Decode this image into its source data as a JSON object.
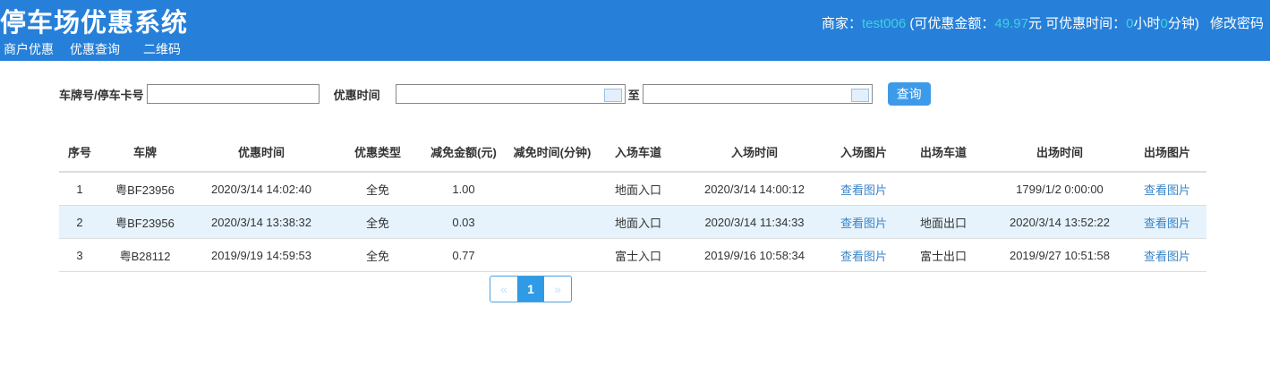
{
  "header": {
    "title": "停车场优惠系统",
    "nav": [
      "商户优惠",
      "优惠查询",
      "二维码"
    ],
    "merchant_label": "商家：",
    "merchant": "test006",
    "amount_label": " (可优惠金额：",
    "amount": "49.97",
    "yuan": "元 可优惠时间：",
    "hours": "0",
    "hour_unit": "小时",
    "minutes": "0",
    "minute_unit": "分钟) ",
    "change_password": "修改密码"
  },
  "search": {
    "plate_label": "车牌号/停车卡号",
    "plate_value": "",
    "time_label": "优惠时间",
    "start": "",
    "to": "至",
    "end": "",
    "query": "查询"
  },
  "table": {
    "columns": [
      "序号",
      "车牌",
      "优惠时间",
      "优惠类型",
      "减免金额(元)",
      "减免时间(分钟)",
      "入场车道",
      "入场时间",
      "入场图片",
      "出场车道",
      "出场时间",
      "出场图片"
    ],
    "rows": [
      [
        "1",
        "粤BF23956",
        "2020/3/14 14:02:40",
        "全免",
        "1.00",
        "",
        "地面入口",
        "2020/3/14 14:00:12",
        "查看图片",
        "",
        "1799/1/2 0:00:00",
        "查看图片"
      ],
      [
        "2",
        "粤BF23956",
        "2020/3/14 13:38:32",
        "全免",
        "0.03",
        "",
        "地面入口",
        "2020/3/14 11:34:33",
        "查看图片",
        "地面出口",
        "2020/3/14 13:52:22",
        "查看图片"
      ],
      [
        "3",
        "粤B28112",
        "2019/9/19 14:59:53",
        "全免",
        "0.77",
        "",
        "富士入口",
        "2019/9/16 10:58:34",
        "查看图片",
        "富士出口",
        "2019/9/27 10:51:58",
        "查看图片"
      ]
    ]
  },
  "pagination": {
    "prev": "«",
    "current": "1",
    "next": "»"
  }
}
